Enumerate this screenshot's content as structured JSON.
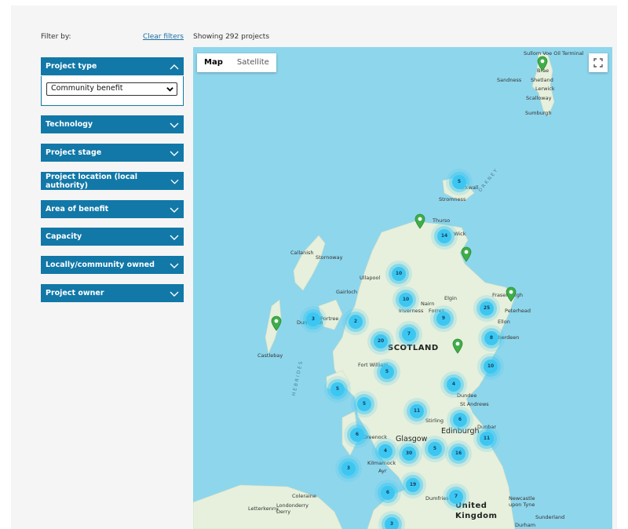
{
  "filters": {
    "title": "Filter by:",
    "clear_label": "Clear filters",
    "showing_text": "Showing 292 projects",
    "open_section": {
      "label": "Project type",
      "selected_value": "Community benefit"
    },
    "sections": [
      {
        "label": "Technology"
      },
      {
        "label": "Project stage"
      },
      {
        "label": "Project location (local authority)"
      },
      {
        "label": "Area of benefit"
      },
      {
        "label": "Capacity"
      },
      {
        "label": "Locally/community owned"
      },
      {
        "label": "Project owner"
      }
    ]
  },
  "map": {
    "type_buttons": {
      "map": "Map",
      "satellite": "Satellite",
      "selected": "Map"
    },
    "fullscreen_icon": "fullscreen-icon",
    "clusters": [
      "5",
      "14",
      "10",
      "10",
      "3",
      "2",
      "9",
      "7",
      "20",
      "25",
      "8",
      "10",
      "5",
      "5",
      "4",
      "5",
      "11",
      "6",
      "6",
      "4",
      "30",
      "5",
      "16",
      "11",
      "3",
      "19",
      "6",
      "7",
      "3"
    ],
    "places": [
      "Sullom Voe Oil Terminal",
      "Brae",
      "Sandness",
      "Shetland",
      "Lerwick",
      "Scalloway",
      "Sumburgh",
      "Stromness",
      "Kirkwall",
      "ORKNEY",
      "Thurso",
      "Wick",
      "Callanish",
      "Stornoway",
      "Ullapool",
      "Gairloch",
      "Nairn",
      "Elgin",
      "Inverness",
      "Forres",
      "Fraserburgh",
      "Peterhead",
      "Ellon",
      "Aberdeen",
      "SCOTLAND",
      "Castlebay",
      "HEBRIDES",
      "Dunvegan",
      "Portree",
      "Fort William",
      "Dundee",
      "St Andrews",
      "Stirling",
      "Edinburgh",
      "Dunbar",
      "Greenock",
      "Glasgow",
      "Kilmarnock",
      "Ayr",
      "Dumfries",
      "United Kingdom",
      "Newcastle upon Tyne",
      "Sunderland",
      "Durham",
      "Coleraine",
      "Letterkenny",
      "Londonderry Derry"
    ],
    "colors": {
      "water": "#8ed6ec",
      "land": "#e6f0dc",
      "cluster": "#3cc7f2",
      "pin": "#3fae49",
      "accent": "#1278a8"
    }
  }
}
